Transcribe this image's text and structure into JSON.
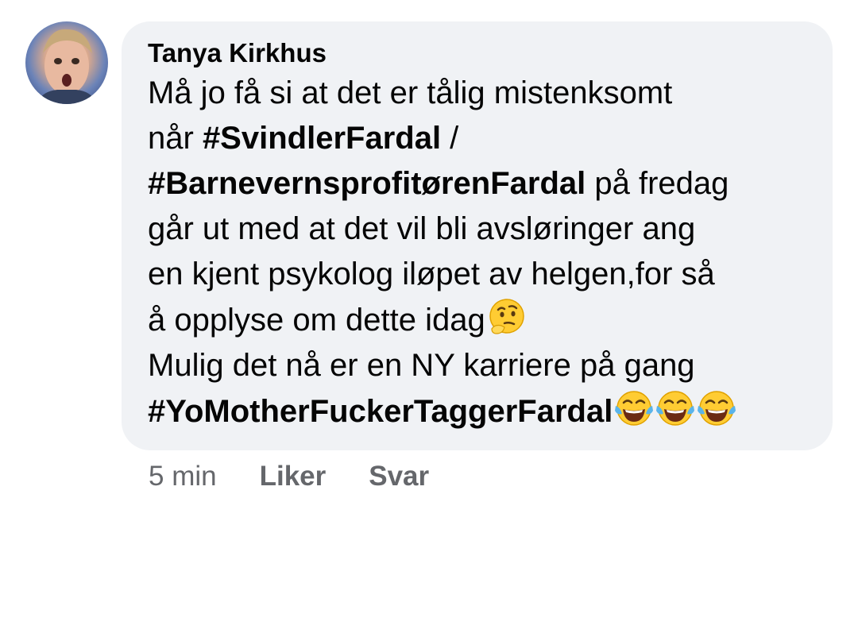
{
  "comment": {
    "author": "Tanya Kirkhus",
    "lines": [
      [
        {
          "t": "Må jo få si at det er tålig mistenksomt",
          "b": false
        }
      ],
      [
        {
          "t": "når ",
          "b": false
        },
        {
          "t": "#SvindlerFardal",
          "b": true
        },
        {
          "t": " /",
          "b": false
        }
      ],
      [
        {
          "t": "#BarnevernsprofitørenFardal",
          "b": true
        },
        {
          "t": " på fredag",
          "b": false
        }
      ],
      [
        {
          "t": "går ut med at det vil bli avsløringer ang",
          "b": false
        }
      ],
      [
        {
          "t": "en kjent psykolog iløpet av helgen,for så",
          "b": false
        }
      ],
      [
        {
          "t": "å opplyse om dette idag",
          "b": false
        },
        {
          "e": "thinking-face-emoji"
        }
      ],
      [
        {
          "t": "Mulig det nå er en NY karriere på gang",
          "b": false
        }
      ],
      [
        {
          "t": "#YoMotherFuckerTaggerFardal",
          "b": true
        },
        {
          "e": "tears-of-joy-emoji"
        },
        {
          "e": "tears-of-joy-emoji"
        },
        {
          "e": "tears-of-joy-emoji"
        }
      ]
    ]
  },
  "actions": {
    "time": "5 min",
    "like": "Liker",
    "reply": "Svar"
  },
  "colors": {
    "bubble_bg": "#f0f2f5",
    "text": "#050505",
    "secondary": "#65676b",
    "emoji_yellow": "#ffcc33"
  }
}
